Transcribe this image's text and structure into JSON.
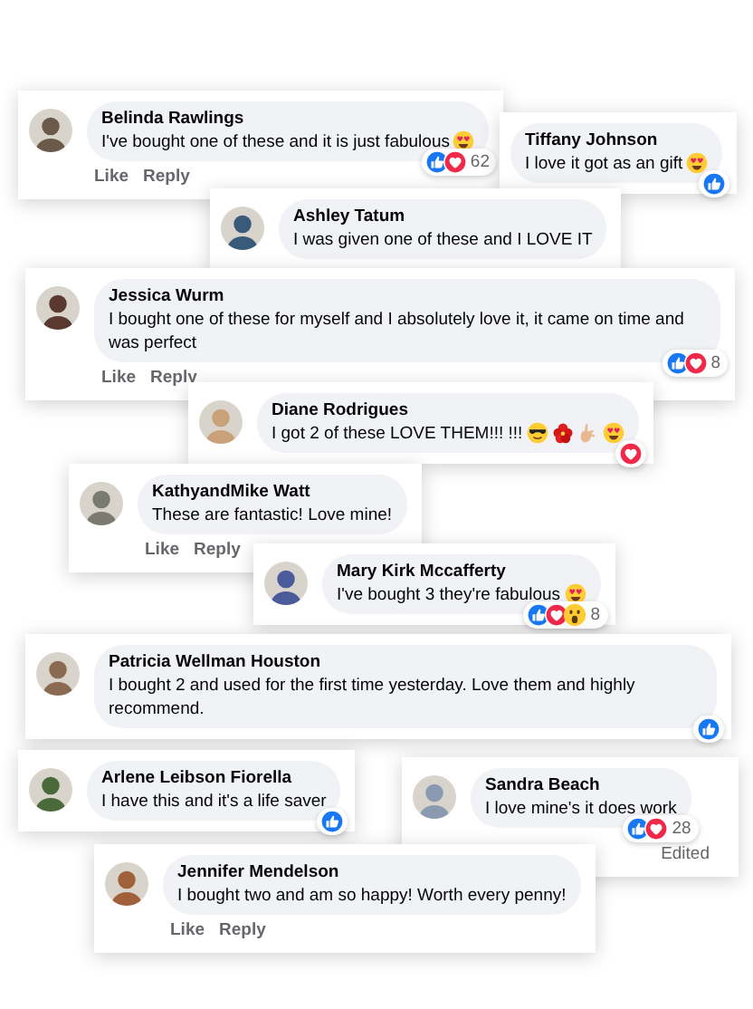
{
  "comments": [
    {
      "name": "Belinda Rawlings",
      "text": "I've bought one of these and it is just fabulous",
      "emojis": [
        {
          "kind": "heart_eyes"
        }
      ],
      "reactions": [
        {
          "kind": "like"
        },
        {
          "kind": "love"
        }
      ],
      "reaction_count": "62",
      "actions": [
        "Like",
        "Reply"
      ]
    },
    {
      "name": "Tiffany Johnson",
      "text": "I love it got as an gift",
      "emojis": [
        {
          "kind": "heart_eyes"
        }
      ],
      "reactions": [
        {
          "kind": "like"
        }
      ]
    },
    {
      "name": "Ashley Tatum",
      "text": "I was given one of these and I LOVE IT"
    },
    {
      "name": "Jessica Wurm",
      "text": "I bought one of these for myself and I absolutely love it, it came on time and was perfect",
      "reactions": [
        {
          "kind": "like"
        },
        {
          "kind": "love"
        }
      ],
      "reaction_count": "8",
      "actions": [
        "Like",
        "Reply"
      ]
    },
    {
      "name": "Diane Rodrigues",
      "text": "I got 2 of these LOVE THEM!!! !!!",
      "emojis": [
        {
          "kind": "sunglasses"
        },
        {
          "kind": "hibiscus"
        },
        {
          "kind": "hand"
        },
        {
          "kind": "heart_eyes"
        }
      ],
      "reactions": [
        {
          "kind": "love"
        }
      ]
    },
    {
      "name": "KathyandMike Watt",
      "text": "These are fantastic! Love mine!",
      "actions": [
        "Like",
        "Reply"
      ]
    },
    {
      "name": "Mary Kirk Mccafferty",
      "text": "I've bought 3 they're fabulous",
      "emojis": [
        {
          "kind": "heart_eyes"
        }
      ],
      "reactions": [
        {
          "kind": "like"
        },
        {
          "kind": "love"
        },
        {
          "kind": "wow"
        }
      ],
      "reaction_count": "8"
    },
    {
      "name": "Patricia Wellman Houston",
      "text": "I bought 2 and used for the first time yesterday. Love them and highly recommend.",
      "reactions": [
        {
          "kind": "like"
        }
      ]
    },
    {
      "name": "Arlene Leibson Fiorella",
      "text": "I have this and it's a life saver",
      "reactions": [
        {
          "kind": "like"
        }
      ]
    },
    {
      "name": "Sandra Beach",
      "text": "I love mine's it does work",
      "reactions": [
        {
          "kind": "like"
        },
        {
          "kind": "love"
        }
      ],
      "reaction_count": "28",
      "edited": "Edited"
    },
    {
      "name": "Jennifer Mendelson",
      "text": "I bought two and am so happy! Worth every penny!",
      "actions": [
        "Like",
        "Reply"
      ]
    }
  ]
}
